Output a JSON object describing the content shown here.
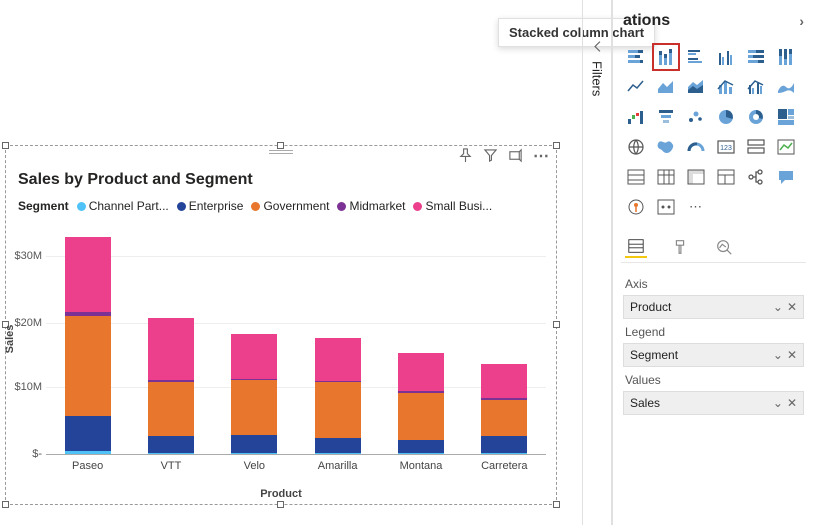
{
  "tooltip": {
    "label": "Stacked column chart"
  },
  "chart": {
    "title": "Sales by Product and Segment",
    "legend_label": "Segment",
    "ylabel": "Sales",
    "xlabel": "Product",
    "yticks": [
      "$30M",
      "$20M",
      "$10M",
      "$-"
    ]
  },
  "chart_data": {
    "type": "bar",
    "stacked": true,
    "ylabel": "Sales",
    "xlabel": "Product",
    "title": "Sales by Product and Segment",
    "y_format": "$,.0fM",
    "ylim": [
      0,
      35000000
    ],
    "categories": [
      "Paseo",
      "VTT",
      "Velo",
      "Amarilla",
      "Montana",
      "Carretera"
    ],
    "series": [
      {
        "name": "Channel Part...",
        "color": "#4fc3f7",
        "values": [
          500000,
          200000,
          100000,
          100000,
          200000,
          200000
        ]
      },
      {
        "name": "Enterprise",
        "color": "#234499",
        "values": [
          5300000,
          2500000,
          2800000,
          2300000,
          2000000,
          2500000
        ]
      },
      {
        "name": "Government",
        "color": "#e8762c",
        "values": [
          15200000,
          8200000,
          8300000,
          8500000,
          7100000,
          5500000
        ]
      },
      {
        "name": "Midmarket",
        "color": "#7b3294",
        "values": [
          600000,
          300000,
          200000,
          200000,
          300000,
          400000
        ]
      },
      {
        "name": "Small Busi...",
        "color": "#ec3f8c",
        "values": [
          11400000,
          9500000,
          6800000,
          6600000,
          5800000,
          5100000
        ]
      }
    ]
  },
  "filters": {
    "label": "Filters"
  },
  "viz_pane": {
    "title_fragment": "ations",
    "fields": {
      "axis_label": "Axis",
      "axis_value": "Product",
      "legend_label": "Legend",
      "legend_value": "Segment",
      "values_label": "Values",
      "values_value": "Sales"
    }
  }
}
